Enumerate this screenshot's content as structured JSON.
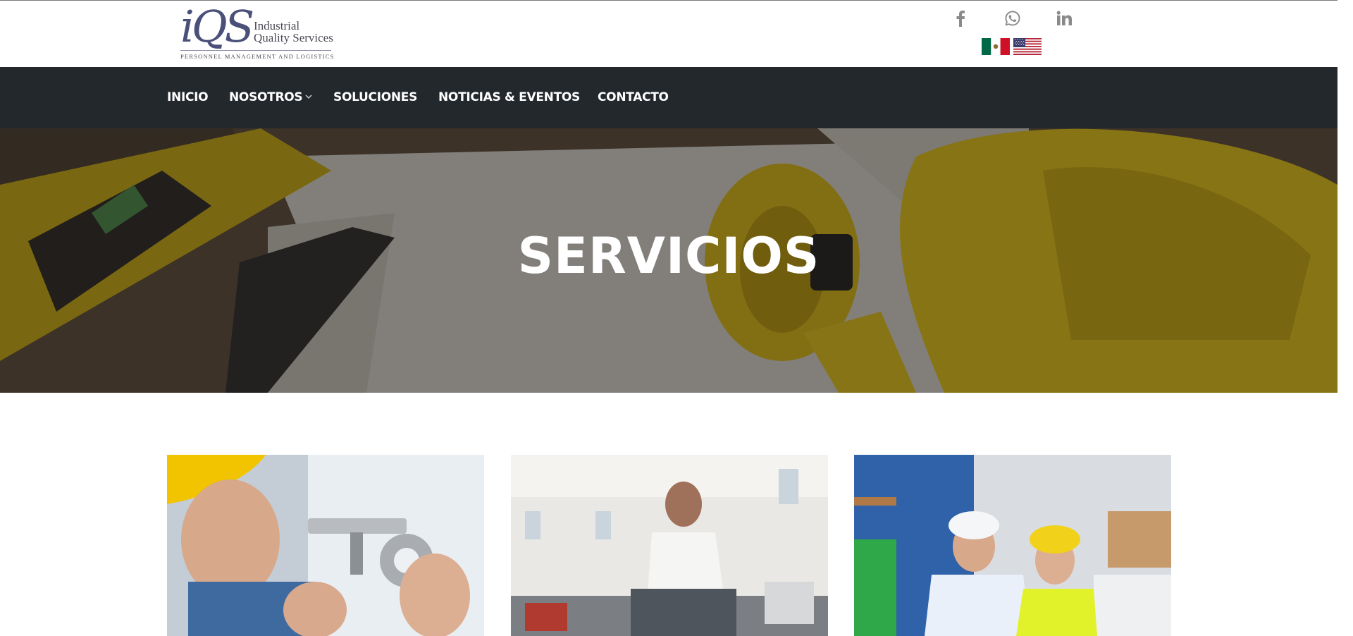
{
  "brand": {
    "logo_mark": "iQS",
    "line1": "Industrial",
    "line2": "Quality Services",
    "tagline": "PERSONNEL MANAGEMENT AND LOGISTICS"
  },
  "social": {
    "icons": [
      "facebook-icon",
      "whatsapp-icon",
      "linkedin-icon"
    ]
  },
  "languages": [
    "mexico-flag",
    "usa-flag"
  ],
  "nav": {
    "items": [
      {
        "label": "INICIO"
      },
      {
        "label": "NOSOTROS"
      },
      {
        "label": "SOLUCIONES"
      },
      {
        "label": "NOTICIAS & EVENTOS"
      },
      {
        "label": "CONTACTO"
      }
    ]
  },
  "hero": {
    "title": "SERVICIOS"
  },
  "colors": {
    "nav_bg": "#23282d",
    "logo": "#4a5079",
    "icon_gray": "#8a8a8a"
  }
}
